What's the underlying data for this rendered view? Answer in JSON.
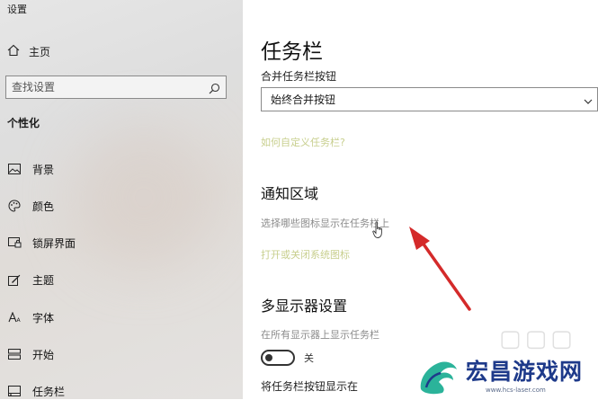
{
  "window": {
    "title": "设置"
  },
  "sidebar": {
    "home_label": "主页",
    "search_placeholder": "查找设置",
    "section_title": "个性化",
    "items": [
      {
        "label": "背景",
        "icon": "picture-icon"
      },
      {
        "label": "颜色",
        "icon": "palette-icon"
      },
      {
        "label": "锁屏界面",
        "icon": "lock-screen-icon"
      },
      {
        "label": "主题",
        "icon": "theme-brush-icon"
      },
      {
        "label": "字体",
        "icon": "font-icon"
      },
      {
        "label": "开始",
        "icon": "start-icon"
      },
      {
        "label": "任务栏",
        "icon": "taskbar-icon"
      }
    ]
  },
  "main": {
    "title": "任务栏",
    "combine_label": "合并任务栏按钮",
    "combine_value": "始终合并按钮",
    "customize_link": "如何自定义任务栏?",
    "notification_title": "通知区域",
    "notification_link1": "选择哪些图标显示在任务栏上",
    "notification_link2": "打开或关闭系统图标",
    "multi_title": "多显示器设置",
    "multi_show_label": "在所有显示器上显示任务栏",
    "toggle_state": "关",
    "taskbar_buttons_label": "将任务栏按钮显示在"
  },
  "watermark": {
    "text": "宏昌游戏网",
    "url": "www.hcs-laser.com"
  },
  "colors": {
    "link": "#c8cf8e",
    "arrow": "#d42a2a",
    "watermark": "#1e3a8a"
  }
}
